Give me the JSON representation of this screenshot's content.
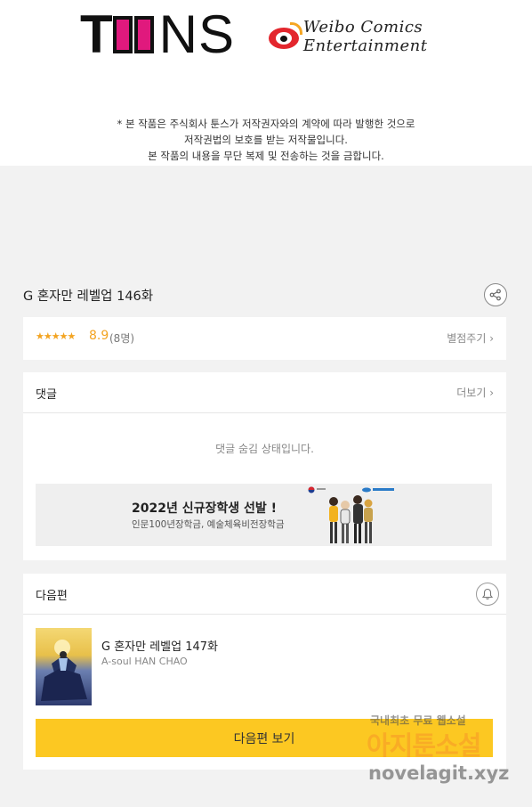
{
  "header": {
    "toons_logo": "TOONS",
    "weibo_logo_text": "Weibo Comics Entertainment",
    "notice_lines": [
      "* 본 작품은 주식회사 툰스가 저작권자와의 계약에 따라 발행한 것으로",
      "저작권법의 보호를 받는 저작물입니다.",
      "본 작품의 내용을 무단 복제 및 전송하는 것을 금합니다."
    ]
  },
  "episode": {
    "title": "G 혼자만 레벨업 146화",
    "share_icon": "share-icon"
  },
  "rating": {
    "stars": "★★★★★",
    "star_value": 4.5,
    "score": "8.9",
    "count": "(8명)",
    "rate_link": "별점주기 ›"
  },
  "comments": {
    "title": "댓글",
    "more_link": "더보기 ›",
    "hidden_message": "댓글 숨김 상태입니다.",
    "banner": {
      "title": "2022년 신규장학생 선발 !",
      "subtitle": "인문100년장학금, 예술체육비전장학금"
    }
  },
  "next": {
    "title": "다음편",
    "bell_icon": "bell-icon",
    "episode_title": "G 혼자만 레벨업 147화",
    "author": "A-soul HAN CHAO",
    "button_label": "다음편 보기"
  },
  "watermark": {
    "line1": "국내최초 무료 웹소설",
    "line2": "아지툰소설",
    "line3": "novelagit.xyz"
  },
  "colors": {
    "accent_yellow": "#fcc822",
    "star_orange": "#f3a422",
    "toons_pink": "#e0197d",
    "weibo_red": "#e3262d"
  }
}
